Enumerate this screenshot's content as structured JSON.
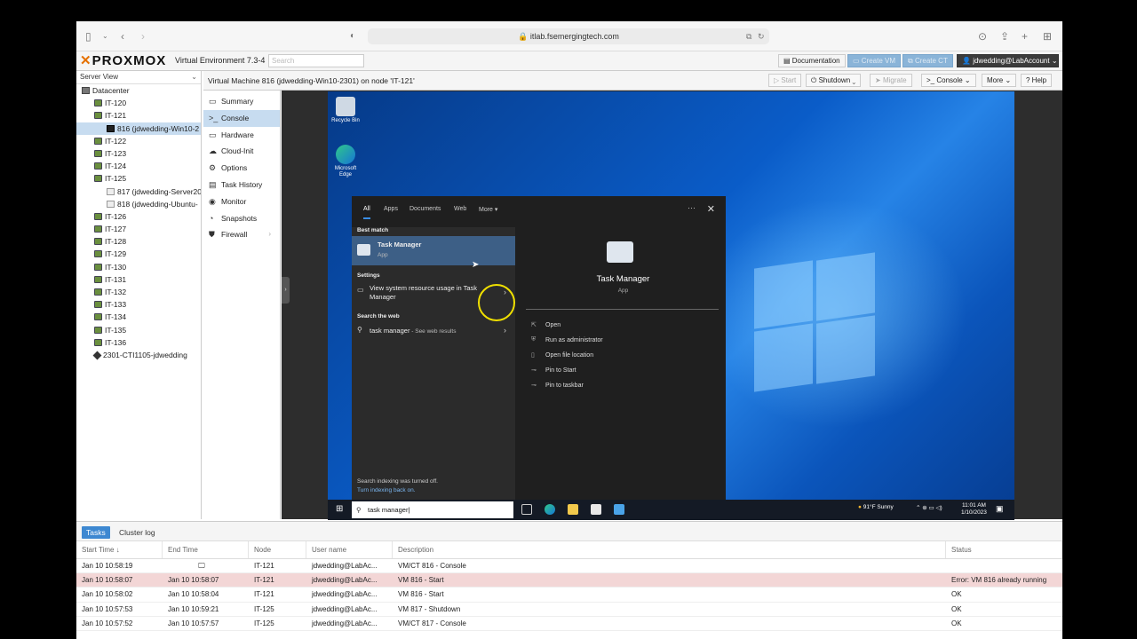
{
  "browser": {
    "url": "itlab.fsemergingtech.com"
  },
  "header": {
    "logo": "PROXMOX",
    "version": "Virtual Environment 7.3-4",
    "search_placeholder": "Search",
    "documentation": "Documentation",
    "create_vm": "Create VM",
    "create_ct": "Create CT",
    "user": "jdwedding@LabAccount"
  },
  "tree": {
    "view": "Server View",
    "nodes": [
      {
        "label": "Datacenter",
        "type": "dc",
        "indent": 0
      },
      {
        "label": "IT-120",
        "type": "srv",
        "indent": 1
      },
      {
        "label": "IT-121",
        "type": "srv",
        "indent": 1
      },
      {
        "label": "816 (jdwedding-Win10-2",
        "type": "mon",
        "indent": 2,
        "selected": true
      },
      {
        "label": "IT-122",
        "type": "srv",
        "indent": 1
      },
      {
        "label": "IT-123",
        "type": "srv",
        "indent": 1
      },
      {
        "label": "IT-124",
        "type": "srv",
        "indent": 1
      },
      {
        "label": "IT-125",
        "type": "srv",
        "indent": 1
      },
      {
        "label": "817 (jdwedding-Server20",
        "type": "vmoff",
        "indent": 2
      },
      {
        "label": "818 (jdwedding-Ubuntu-",
        "type": "vmoff",
        "indent": 2
      },
      {
        "label": "IT-126",
        "type": "srv",
        "indent": 1
      },
      {
        "label": "IT-127",
        "type": "srv",
        "indent": 1
      },
      {
        "label": "IT-128",
        "type": "srv",
        "indent": 1
      },
      {
        "label": "IT-129",
        "type": "srv",
        "indent": 1
      },
      {
        "label": "IT-130",
        "type": "srv",
        "indent": 1
      },
      {
        "label": "IT-131",
        "type": "srv",
        "indent": 1
      },
      {
        "label": "IT-132",
        "type": "srv",
        "indent": 1
      },
      {
        "label": "IT-133",
        "type": "srv",
        "indent": 1
      },
      {
        "label": "IT-134",
        "type": "srv",
        "indent": 1
      },
      {
        "label": "IT-135",
        "type": "srv",
        "indent": 1
      },
      {
        "label": "IT-136",
        "type": "srv",
        "indent": 1
      },
      {
        "label": "2301-CTI1105-jdwedding",
        "type": "tag",
        "indent": 1
      }
    ]
  },
  "nav": {
    "items": [
      {
        "label": "Summary",
        "icon": "▭"
      },
      {
        "label": "Console",
        "icon": ">_",
        "selected": true
      },
      {
        "label": "Hardware",
        "icon": "▭"
      },
      {
        "label": "Cloud-Init",
        "icon": "☁"
      },
      {
        "label": "Options",
        "icon": "⚙"
      },
      {
        "label": "Task History",
        "icon": "▤"
      },
      {
        "label": "Monitor",
        "icon": "◉"
      },
      {
        "label": "Snapshots",
        "icon": "◔"
      },
      {
        "label": "Firewall",
        "icon": "⛊",
        "arrow": true
      }
    ]
  },
  "vmbar": {
    "title": "Virtual Machine 816 (jdwedding-Win10-2301) on node 'IT-121'",
    "start": "Start",
    "shutdown": "Shutdown",
    "migrate": "Migrate",
    "console": "Console",
    "more": "More",
    "help": "Help"
  },
  "desktop": {
    "recycle": "Recycle Bin",
    "edge": "Microsoft Edge"
  },
  "startmenu": {
    "tabs": [
      "All",
      "Apps",
      "Documents",
      "Web",
      "More ▾"
    ],
    "best_match": "Best match",
    "best_title": "Task Manager",
    "best_sub": "App",
    "settings_label": "Settings",
    "settings_item": "View system resource usage in Task Manager",
    "web_label": "Search the web",
    "web_item": "task manager",
    "web_sub": " - See web results",
    "index_off": "Search indexing was turned off.",
    "index_on": "Turn indexing back on.",
    "detail_title": "Task Manager",
    "detail_sub": "App",
    "actions": [
      "Open",
      "Run as administrator",
      "Open file location",
      "Pin to Start",
      "Pin to taskbar"
    ]
  },
  "taskbar": {
    "search_text": "task manager",
    "weather": "91°F  Sunny",
    "time": "11:01 AM",
    "date": "1/10/2023"
  },
  "tasks": {
    "tabs": [
      "Tasks",
      "Cluster log"
    ],
    "columns": [
      "Start Time ↓",
      "End Time",
      "Node",
      "User name",
      "Description",
      "Status"
    ],
    "rows": [
      {
        "start": "Jan 10 10:58:19",
        "end": "🖵",
        "node": "IT-121",
        "user": "jdwedding@LabAc...",
        "desc": "VM/CT 816 - Console",
        "status": "",
        "error": false
      },
      {
        "start": "Jan 10 10:58:07",
        "end": "Jan 10 10:58:07",
        "node": "IT-121",
        "user": "jdwedding@LabAc...",
        "desc": "VM 816 - Start",
        "status": "Error: VM 816 already running",
        "error": true
      },
      {
        "start": "Jan 10 10:58:02",
        "end": "Jan 10 10:58:04",
        "node": "IT-121",
        "user": "jdwedding@LabAc...",
        "desc": "VM 816 - Start",
        "status": "OK",
        "error": false
      },
      {
        "start": "Jan 10 10:57:53",
        "end": "Jan 10 10:59:21",
        "node": "IT-125",
        "user": "jdwedding@LabAc...",
        "desc": "VM 817 - Shutdown",
        "status": "OK",
        "error": false
      },
      {
        "start": "Jan 10 10:57:52",
        "end": "Jan 10 10:57:57",
        "node": "IT-125",
        "user": "jdwedding@LabAc...",
        "desc": "VM/CT 817 - Console",
        "status": "OK",
        "error": false
      }
    ]
  }
}
